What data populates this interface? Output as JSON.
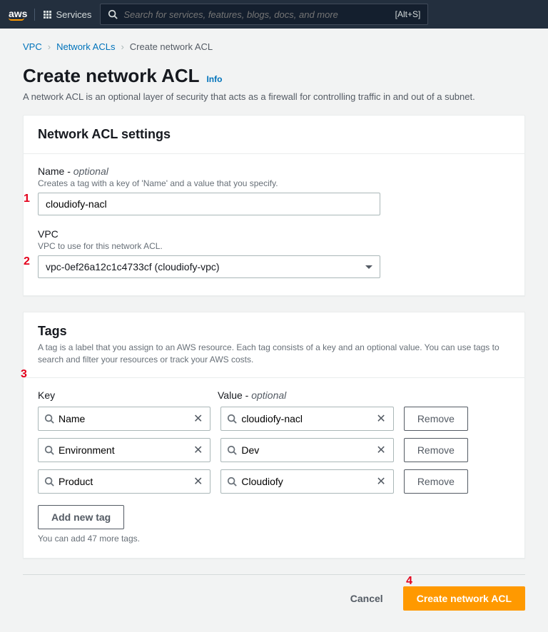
{
  "topbar": {
    "services_label": "Services",
    "search_placeholder": "Search for services, features, blogs, docs, and more",
    "search_shortcut": "[Alt+S]"
  },
  "breadcrumbs": {
    "item1": "VPC",
    "item2": "Network ACLs",
    "item3": "Create network ACL"
  },
  "page": {
    "title": "Create network ACL",
    "info_label": "Info",
    "description": "A network ACL is an optional layer of security that acts as a firewall for controlling traffic in and out of a subnet."
  },
  "settings_panel": {
    "title": "Network ACL settings",
    "name_label": "Name - ",
    "name_optional": "optional",
    "name_desc": "Creates a tag with a key of 'Name' and a value that you specify.",
    "name_value": "cloudiofy-nacl",
    "vpc_label": "VPC",
    "vpc_desc": "VPC to use for this network ACL.",
    "vpc_value": "vpc-0ef26a12c1c4733cf (cloudiofy-vpc)"
  },
  "tags_panel": {
    "title": "Tags",
    "desc": "A tag is a label that you assign to an AWS resource. Each tag consists of a key and an optional value. You can use tags to search and filter your resources or track your AWS costs.",
    "key_col": "Key",
    "value_col_prefix": "Value - ",
    "value_col_optional": "optional",
    "rows": [
      {
        "key": "Name",
        "value": "cloudiofy-nacl"
      },
      {
        "key": "Environment",
        "value": "Dev"
      },
      {
        "key": "Product",
        "value": "Cloudiofy"
      }
    ],
    "remove_label": "Remove",
    "add_label": "Add new tag",
    "limit_text": "You can add 47 more tags."
  },
  "footer": {
    "cancel": "Cancel",
    "submit": "Create network ACL"
  },
  "markers": {
    "m1": "1",
    "m2": "2",
    "m3": "3",
    "m4": "4"
  }
}
